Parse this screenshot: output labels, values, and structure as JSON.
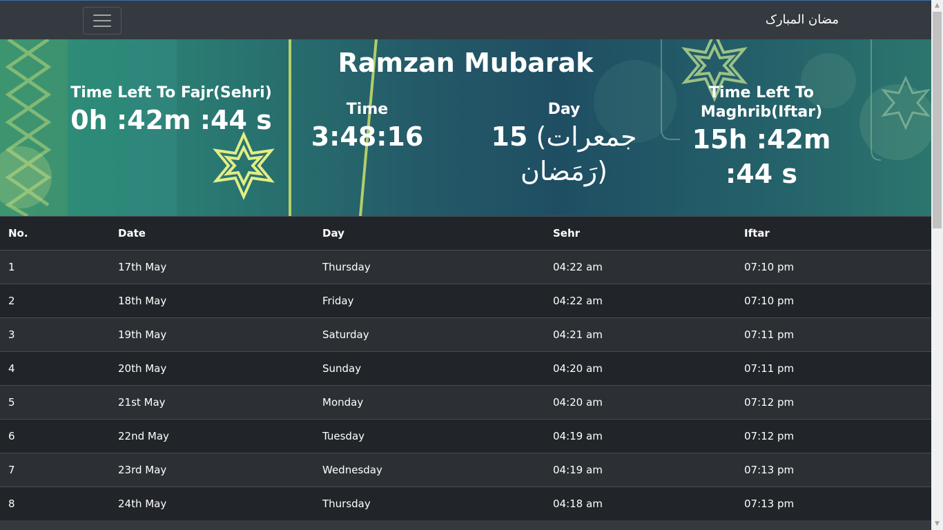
{
  "navbar": {
    "brand": "مضان المبارک"
  },
  "hero": {
    "title": "Ramzan Mubarak",
    "sehri": {
      "label": "Time Left To Fajr(Sehri)",
      "value": "0h :42m :44 s"
    },
    "time": {
      "label": "Time",
      "value": "3:48:16"
    },
    "day": {
      "label": "Day",
      "number": "15",
      "value": "(جمعرات رَمَضان)"
    },
    "iftar": {
      "label": "Time Left To Maghrib(Iftar)",
      "value": "15h :42m :44 s"
    }
  },
  "table": {
    "headers": [
      "No.",
      "Date",
      "Day",
      "Sehr",
      "Iftar"
    ],
    "rows": [
      [
        "1",
        "17th May",
        "Thursday",
        "04:22 am",
        "07:10 pm"
      ],
      [
        "2",
        "18th May",
        "Friday",
        "04:22 am",
        "07:10 pm"
      ],
      [
        "3",
        "19th May",
        "Saturday",
        "04:21 am",
        "07:11 pm"
      ],
      [
        "4",
        "20th May",
        "Sunday",
        "04:20 am",
        "07:11 pm"
      ],
      [
        "5",
        "21st May",
        "Monday",
        "04:20 am",
        "07:12 pm"
      ],
      [
        "6",
        "22nd May",
        "Tuesday",
        "04:19 am",
        "07:12 pm"
      ],
      [
        "7",
        "23rd May",
        "Wednesday",
        "04:19 am",
        "07:13 pm"
      ],
      [
        "8",
        "24th May",
        "Thursday",
        "04:18 am",
        "07:13 pm"
      ]
    ]
  },
  "colors": {
    "navbar": "#343a40",
    "table_header": "#212529",
    "row_odd": "#2c3034",
    "row_even": "#212529"
  }
}
